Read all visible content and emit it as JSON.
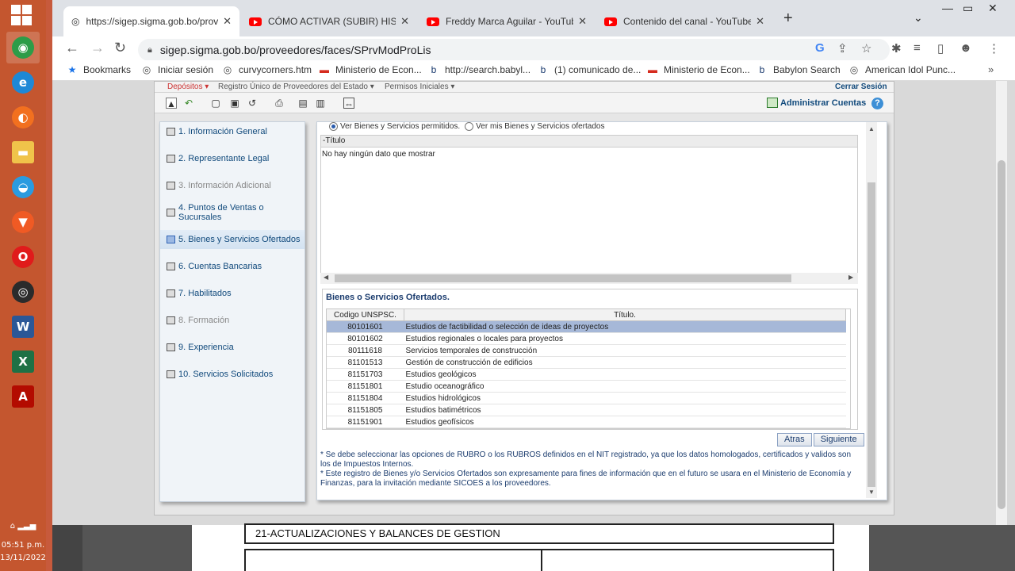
{
  "taskbar": {
    "apps": [
      {
        "icon": "chrome-icon",
        "color": "#2d9c48"
      },
      {
        "icon": "internet-explorer-icon",
        "color": "#1e88d6"
      },
      {
        "icon": "firefox-icon",
        "color": "#f2701f"
      },
      {
        "icon": "file-explorer-icon",
        "color": "#f0c34a"
      },
      {
        "icon": "edge-icon",
        "color": "#2a9be0"
      },
      {
        "icon": "brave-icon",
        "color": "#f05a24"
      },
      {
        "icon": "opera-icon",
        "color": "#e01b1b"
      },
      {
        "icon": "obs-icon",
        "color": "#2b2b2b"
      },
      {
        "icon": "word-icon",
        "color": "#2b5797"
      },
      {
        "icon": "excel-icon",
        "color": "#1e7145"
      },
      {
        "icon": "acrobat-icon",
        "color": "#b30b00"
      }
    ],
    "time": "05:51 p.m.",
    "date": "13/11/2022"
  },
  "browser": {
    "tabs": [
      {
        "title": "https://sigep.sigma.gob.bo/prove",
        "active": true
      },
      {
        "title": "CÓMO ACTIVAR (SUBIR) HISTOR",
        "active": false
      },
      {
        "title": "Freddy Marca Aguilar - YouTube",
        "active": false
      },
      {
        "title": "Contenido del canal - YouTube St",
        "active": false
      }
    ],
    "new_tab": "+",
    "url": "sigep.sigma.gob.bo/proveedores/faces/SPrvModProLis",
    "bookmarks": [
      {
        "label": "Bookmarks",
        "icon": "star-icon"
      },
      {
        "label": "Iniciar sesión",
        "icon": "globe-icon"
      },
      {
        "label": "curvycorners.htm",
        "icon": "globe-icon"
      },
      {
        "label": "Ministerio de Econ...",
        "icon": "flag-bolivia-icon"
      },
      {
        "label": "http://search.babyl...",
        "icon": "babylon-icon"
      },
      {
        "label": "(1) comunicado de...",
        "icon": "babylon-icon"
      },
      {
        "label": "Ministerio de Econ...",
        "icon": "flag-bolivia-icon"
      },
      {
        "label": "Babylon Search",
        "icon": "babylon-icon"
      },
      {
        "label": "American Idol Punc...",
        "icon": "globe-icon"
      }
    ]
  },
  "app": {
    "menu": {
      "item1": "Depósitos ▾",
      "item2": "Registro Único de Proveedores del Estado ▾",
      "item3": "Permisos Iniciales ▾",
      "logout": "Cerrar Sesión"
    },
    "admin_accounts": "Administrar Cuentas",
    "help": "?",
    "nav": [
      {
        "label": "1. Información General",
        "state": "normal"
      },
      {
        "label": "2. Representante Legal",
        "state": "normal"
      },
      {
        "label": "3. Información Adicional",
        "state": "disabled"
      },
      {
        "label": "4. Puntos de Ventas o Sucursales",
        "state": "normal"
      },
      {
        "label": "5. Bienes y Servicios Ofertados",
        "state": "active"
      },
      {
        "label": "6. Cuentas Bancarias",
        "state": "normal"
      },
      {
        "label": "7. Habilitados",
        "state": "normal"
      },
      {
        "label": "8. Formación",
        "state": "disabled"
      },
      {
        "label": "9. Experiencia",
        "state": "normal"
      },
      {
        "label": "10. Servicios Solicitados",
        "state": "normal"
      }
    ],
    "radio_permitted": "Ver Bienes y Servicios permitidos.",
    "radio_mine": "Ver mis Bienes y Servicios ofertados",
    "table1": {
      "header": "-Título",
      "empty": "No hay ningún dato que mostrar"
    },
    "offered": {
      "title": "Bienes o Servicios Ofertados.",
      "col_code": "Codigo UNSPSC.",
      "col_title": "Título.",
      "rows": [
        {
          "code": "80101601",
          "title": "Estudios de factibilidad o selección de ideas de proyectos"
        },
        {
          "code": "80101602",
          "title": "Estudios regionales o locales para proyectos"
        },
        {
          "code": "80111618",
          "title": "Servicios temporales de construcción"
        },
        {
          "code": "81101513",
          "title": "Gestión de construcción de edificios"
        },
        {
          "code": "81151703",
          "title": "Estudios geológicos"
        },
        {
          "code": "81151801",
          "title": "Estudio oceanográfico"
        },
        {
          "code": "81151804",
          "title": "Estudios hidrológicos"
        },
        {
          "code": "81151805",
          "title": "Estudios batimétricos"
        },
        {
          "code": "81151901",
          "title": "Estudios geofísicos"
        }
      ]
    },
    "btn_back": "Atras",
    "btn_next": "Siguiente",
    "note1": "* Se debe seleccionar las opciones de RUBRO o los RUBROS definidos en el NIT registrado, ya que los datos homologados, certificados y validos son los de Impuestos Internos.",
    "note2": "* Este registro de Bienes y/o Servicios Ofertados son expresamente para fines de información que en el futuro se usara en el Ministerio de Economía y Finanzas, para la invitación mediante SICOES a los proveedores."
  },
  "document": {
    "heading": "21-ACTUALIZACIONES Y BALANCES DE GESTION"
  }
}
